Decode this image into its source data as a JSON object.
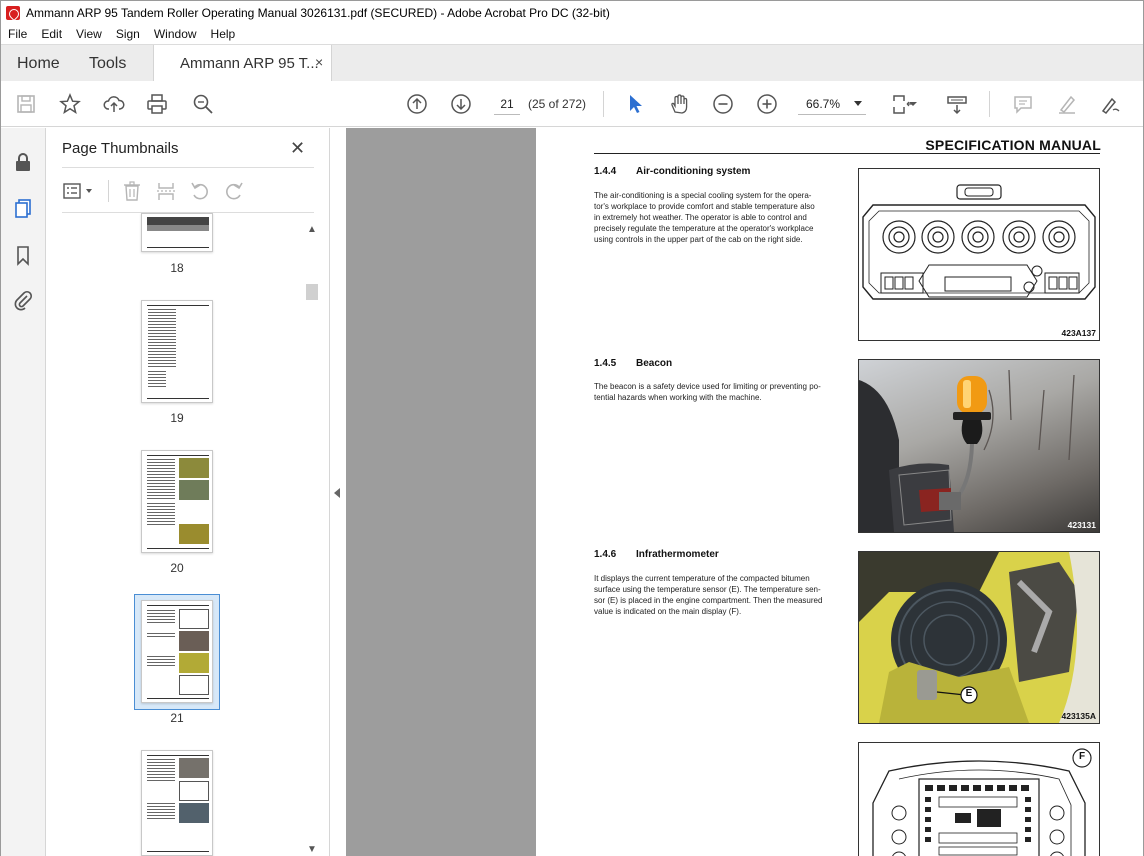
{
  "window": {
    "title": "Ammann ARP 95 Tandem Roller Operating Manual 3026131.pdf (SECURED) - Adobe Acrobat Pro DC (32-bit)"
  },
  "menu": [
    "File",
    "Edit",
    "View",
    "Sign",
    "Window",
    "Help"
  ],
  "tabs": {
    "home": "Home",
    "tools": "Tools",
    "document": "Ammann ARP 95 T...",
    "close": "×"
  },
  "toolbar": {
    "page_input": "21",
    "page_count": "(25 of 272)",
    "zoom": "66.7%"
  },
  "panel": {
    "title": "Page Thumbnails",
    "close": "✕",
    "thumbnails": [
      {
        "label": "18"
      },
      {
        "label": "19"
      },
      {
        "label": "20"
      },
      {
        "label": "21",
        "selected": true
      },
      {
        "label": ""
      }
    ]
  },
  "page": {
    "header": "SPECIFICATION MANUAL",
    "sections": [
      {
        "number": "1.4.4",
        "title": "Air-conditioning system",
        "lines": [
          "The air-conditioning is a special cooling system for the opera-",
          "tor's workplace to provide comfort and stable temperature also",
          "in extremely hot weather. The operator is able to control and",
          "precisely regulate the temperature at the operator's workplace",
          "using controls in the upper part of the cab on the right side."
        ],
        "figure_code": "423A137"
      },
      {
        "number": "1.4.5",
        "title": "Beacon",
        "lines": [
          "The beacon is a safety device used for limiting or preventing po-",
          "tential hazards when working with the machine."
        ],
        "figure_code": "423131"
      },
      {
        "number": "1.4.6",
        "title": "Infrathermometer",
        "lines": [
          "It displays the current temperature of the compacted bitumen",
          "surface using the temperature sensor (E). The temperature sen-",
          "sor (E) is placed in the engine compartment. Then the measured",
          "value is indicated on the main display (F)."
        ],
        "figure_code": "423135A",
        "callout_e": "E"
      },
      {
        "callout_f": "F"
      }
    ]
  }
}
